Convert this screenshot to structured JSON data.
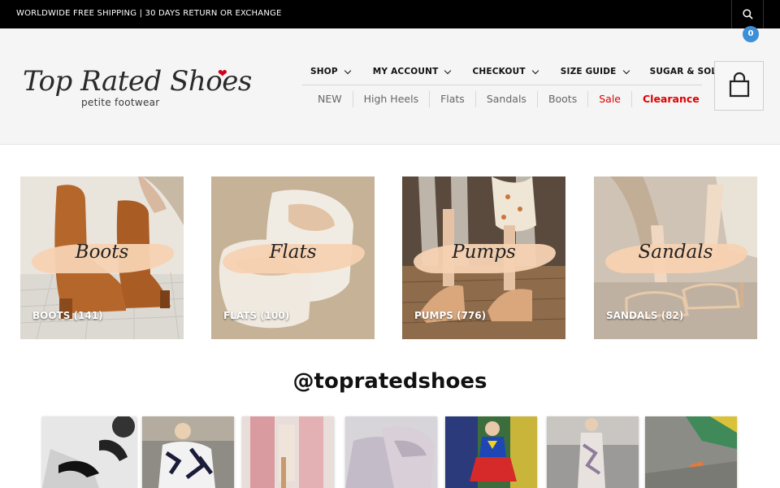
{
  "topbar": {
    "shipping_text": "WORLDWIDE FREE SHIPPING | 30 DAYS RETURN OR EXCHANGE",
    "search_icon": "search-icon"
  },
  "logo": {
    "title": "Top Rated Shoes",
    "subtitle": "petite footwear",
    "accent": "#d0021b"
  },
  "main_nav": [
    {
      "label": "SHOP",
      "dropdown": true
    },
    {
      "label": "MY ACCOUNT",
      "dropdown": true
    },
    {
      "label": "CHECKOUT",
      "dropdown": true
    },
    {
      "label": "SIZE GUIDE",
      "dropdown": true
    },
    {
      "label": "SUGAR & SOLE",
      "dropdown": false
    }
  ],
  "sub_nav": [
    {
      "label": "NEW"
    },
    {
      "label": "High Heels"
    },
    {
      "label": "Flats"
    },
    {
      "label": "Sandals"
    },
    {
      "label": "Boots"
    },
    {
      "label": "Sale",
      "color": "#e00000"
    },
    {
      "label": "Clearance",
      "color": "#e00000"
    }
  ],
  "cart": {
    "count": "0",
    "icon": "shopping-bag-icon",
    "badge_color": "#3d8fd8"
  },
  "categories": [
    {
      "script": "Boots",
      "count_label": "BOOTS (141)"
    },
    {
      "script": "Flats",
      "count_label": "FLATS (100)"
    },
    {
      "script": "Pumps",
      "count_label": "PUMPS (776)"
    },
    {
      "script": "Sandals",
      "count_label": "SANDALS (82)"
    }
  ],
  "instagram": {
    "handle": "@topratedshoes",
    "post_count": 7
  }
}
